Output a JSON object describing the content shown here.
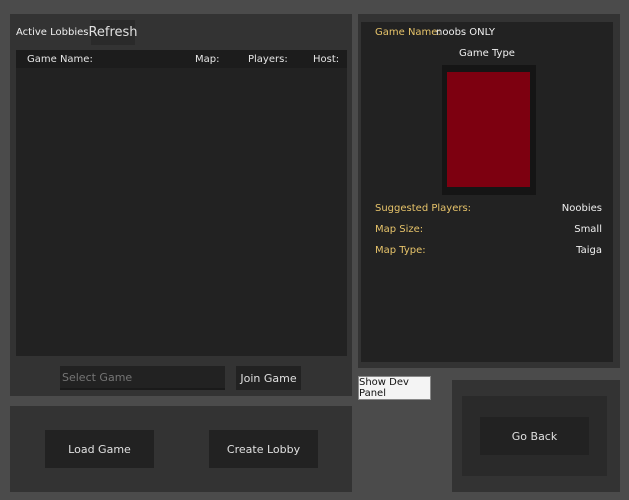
{
  "lobbies": {
    "title": "Active Lobbies",
    "refresh_label": "Refresh",
    "columns": [
      "Game Name:",
      "Map:",
      "Players:",
      "Host:"
    ],
    "rows": [],
    "select_placeholder": "Select Game",
    "join_label": "Join Game"
  },
  "actions": {
    "load_label": "Load Game",
    "create_label": "Create Lobby"
  },
  "details": {
    "game_name_label": "Game Name:",
    "game_name_value": "noobs ONLY",
    "game_type_label": "Game Type",
    "preview_color": "#7d0010",
    "suggested_players_label": "Suggested Players:",
    "suggested_players_value": "Noobies",
    "map_size_label": "Map Size:",
    "map_size_value": "Small",
    "map_type_label": "Map Type:",
    "map_type_value": "Taiga"
  },
  "dev": {
    "show_dev_label": "Show Dev Panel"
  },
  "nav": {
    "go_back_label": "Go Back"
  }
}
